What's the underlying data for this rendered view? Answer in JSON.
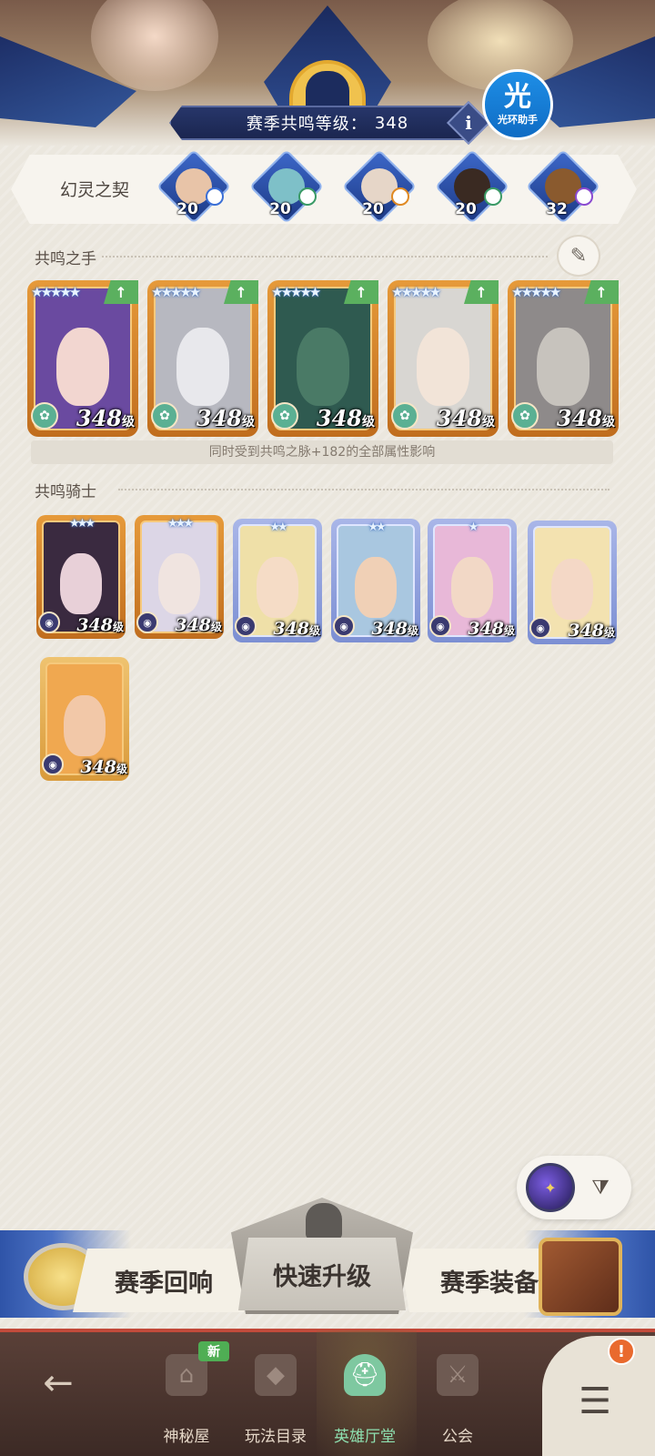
{
  "header": {
    "season_label": "赛季共鸣等级：",
    "season_value": "348",
    "info_glyph": "i",
    "helper_big": "光",
    "helper_small": "光环助手"
  },
  "contract": {
    "title": "幻灵之契",
    "items": [
      {
        "level": "20",
        "face": "#e8c4a8",
        "elem": "#3b6fd6"
      },
      {
        "level": "20",
        "face": "#7ec0c8",
        "elem": "#3a9a66"
      },
      {
        "level": "20",
        "face": "#e6d6c8",
        "elem": "#e08a24"
      },
      {
        "level": "20",
        "face": "#3a2a22",
        "elem": "#3a9a66"
      },
      {
        "level": "32",
        "face": "#8a5a2e",
        "elem": "#8a4ad0"
      }
    ]
  },
  "hands": {
    "title": "共鸣之手",
    "up_glyph": "↑",
    "cards": [
      {
        "level": "348",
        "unit": "级",
        "bg": "#6a4aa0",
        "face": "#f2d6d0"
      },
      {
        "level": "348",
        "unit": "级",
        "bg": "#b7b8c0",
        "face": "#e8e8ec"
      },
      {
        "level": "348",
        "unit": "级",
        "bg": "#2f5a50",
        "face": "#4a7a66"
      },
      {
        "level": "348",
        "unit": "级",
        "bg": "#d8d6d2",
        "face": "#f2e4d8"
      },
      {
        "level": "348",
        "unit": "级",
        "bg": "#8e8a8a",
        "face": "#c7c3bd"
      }
    ],
    "note": "同时受到共鸣之脉+182的全部属性影响",
    "stars": "★★★★★"
  },
  "knights": {
    "title": "共鸣骑士",
    "cards": [
      {
        "level": "348",
        "unit": "级",
        "stars": "★★★",
        "bg": "#3a2a40",
        "face": "#e8d0d8"
      },
      {
        "level": "348",
        "unit": "级",
        "stars": "★★★",
        "bg": "#dcd6e6",
        "face": "#f0e4e0"
      },
      {
        "level": "348",
        "unit": "级",
        "stars": "★★",
        "bg": "#efe0a8",
        "face": "#f5dcc6"
      },
      {
        "level": "348",
        "unit": "级",
        "stars": "★★",
        "bg": "#a9c7e0",
        "face": "#f0d0b6"
      },
      {
        "level": "348",
        "unit": "级",
        "stars": "★",
        "bg": "#e8b8d8",
        "face": "#f2d8c6"
      },
      {
        "level": "348",
        "unit": "级",
        "stars": "",
        "bg": "#f3e2b0",
        "face": "#f4d8c6"
      },
      {
        "level": "348",
        "unit": "级",
        "stars": "",
        "bg": "#f0a850",
        "face": "#f2c8a8"
      }
    ]
  },
  "actions": {
    "left": "赛季回响",
    "center": "快速升级",
    "right": "赛季装备"
  },
  "nav": {
    "items": [
      {
        "label": "神秘屋"
      },
      {
        "label": "玩法目录"
      },
      {
        "label": "英雄厅堂"
      },
      {
        "label": "公会"
      }
    ],
    "new_badge": "新",
    "alert": "!"
  },
  "colors": {
    "accent_green": "#5bb05f",
    "card_orange": "#e69a3a",
    "nav_bg": "#3c2a25",
    "banner_blue": "#1b2650"
  }
}
